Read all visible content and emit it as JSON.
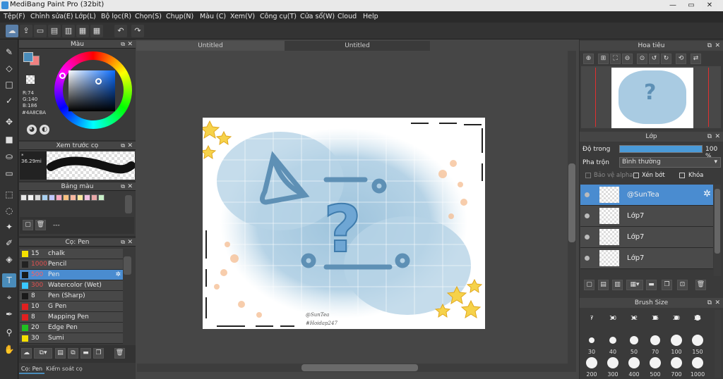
{
  "window": {
    "title": "MediBang Paint Pro (32bit)",
    "controls": [
      "—",
      "▭",
      "✕"
    ]
  },
  "menu": [
    "Tệp(F)",
    "Chỉnh sửa(E)",
    "Lớp(L)",
    "Bộ lọc(R)",
    "Chọn(S)",
    "Chụp(N)",
    "Màu (C)",
    "Xem(V)",
    "Công cụ(T)",
    "Cửa sổ(W)",
    "Cloud",
    "Help"
  ],
  "toolbar": {
    "icons": [
      "cloud-icon",
      "share-icon",
      "comment-icon",
      "note-icon",
      "page-icon",
      "page-list-icon",
      "grid-icon",
      "undo-icon",
      "redo-icon"
    ]
  },
  "color_panel": {
    "title": "Màu",
    "r_label": "R:74",
    "g_label": "G:140",
    "b_label": "B:186",
    "hex": "#4A8CBA",
    "main_color": "#4a8cba",
    "sub_color": "#f08080"
  },
  "brush_preview": {
    "title": "Xem trước cọ",
    "size": "36.29mi"
  },
  "palette": {
    "title": "Bảng màu",
    "value": "---",
    "swatches": [
      "#e8e8e8",
      "#f4f4f4",
      "#d8d8d8",
      "#a8d0f0",
      "#c0c8ff",
      "#f8a8c0",
      "#f8c080",
      "#f8b8a0",
      "#f8e8a0",
      "#f0c0e0",
      "#e8a8a8",
      "#c8f0c8"
    ]
  },
  "brush_panel": {
    "title": "Cọ: Pen",
    "items": [
      {
        "size": "15",
        "name": "chalk",
        "color": "#f5e000"
      },
      {
        "size": "1000",
        "name": "Pencil",
        "color": "#222222",
        "size_color": "#e05050"
      },
      {
        "size": "500",
        "name": "Pen",
        "color": "#1a1a1a",
        "selected": true,
        "size_color": "#ff6060"
      },
      {
        "size": "300",
        "name": "Watercolor (Wet)",
        "color": "#3ac8ff",
        "size_color": "#e05050"
      },
      {
        "size": "8",
        "name": "Pen (Sharp)",
        "color": "#1a1a1a"
      },
      {
        "size": "10",
        "name": "G Pen",
        "color": "#e02020"
      },
      {
        "size": "8",
        "name": "Mapping Pen",
        "color": "#e02020"
      },
      {
        "size": "20",
        "name": "Edge Pen",
        "color": "#20c020"
      },
      {
        "size": "30",
        "name": "Sumi",
        "color": "#f5e000"
      }
    ]
  },
  "bottom_tabs": [
    "Cọ: Pen",
    "Kiểm soát cọ"
  ],
  "doc_tabs": [
    "Untitled",
    "Untitled"
  ],
  "canvas": {
    "signature_1": "@SunTea",
    "signature_2": "#Hoidap247",
    "question": "?"
  },
  "navigator": {
    "title": "Hoa tiêu"
  },
  "layers": {
    "title": "Lớp",
    "opacity_label": "Độ trong",
    "opacity_value": "100 %",
    "opacity": 1.0,
    "blend_label": "Pha trộn",
    "blend_value": "Bình thường",
    "protect_alpha": "Bảo vệ alpha",
    "clipping": "Xén bớt",
    "lock": "Khóa",
    "items": [
      {
        "name": "@SunTea",
        "selected": true
      },
      {
        "name": "Lớp7"
      },
      {
        "name": "Lớp7"
      },
      {
        "name": "Lớp7"
      }
    ]
  },
  "brush_size": {
    "title": "Brush Size",
    "rows": [
      [
        "7",
        "10",
        "12",
        "15",
        "20",
        "25"
      ],
      [
        "30",
        "40",
        "50",
        "70",
        "100",
        "150"
      ],
      [
        "200",
        "300",
        "400",
        "500",
        "700",
        "1000"
      ]
    ]
  }
}
